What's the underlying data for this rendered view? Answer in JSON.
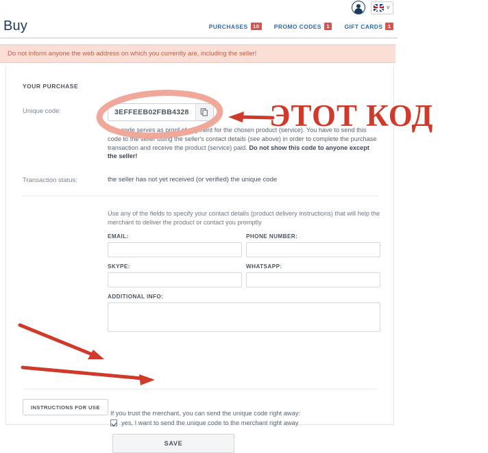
{
  "topbar": {
    "avatar_icon": "user-avatar-icon",
    "language_flag": "uk-flag-icon",
    "caret": "˅"
  },
  "header": {
    "brand": "Buy",
    "nav": [
      {
        "label": "PURCHASES",
        "badge": "10"
      },
      {
        "label": "PROMO CODES",
        "badge": "1"
      },
      {
        "label": "GIFT CARDS",
        "badge": "1"
      }
    ]
  },
  "warning": {
    "text": "Do not inform anyone the web address on which you currently are, including the seller!"
  },
  "purchase": {
    "section_title": "YOUR PURCHASE",
    "unique_code_label": "Unique code:",
    "unique_code_value": "3EFFEEB02FBB4328",
    "copy_icon": "copy-icon",
    "code_description_part1": "This code serves as proof of payment for the chosen product (service). You have to send this code to the seller using the seller's contact details (see above) in order to complete the purchase transaction and receive the product (service) paid. ",
    "code_description_bold": "Do not show this code to anyone except the seller!",
    "transaction_status_label": "Transaction status:",
    "transaction_status_value": "the seller has not yet received (or verified) the unique code"
  },
  "contact": {
    "hint": "Use any of the fields to specify your contact details (product delivery instructions) that will help the merchant to deliver the product or contact you promptly",
    "fields": {
      "email_label": "EMAIL:",
      "email_value": "",
      "email_placeholder": "",
      "phone_label": "PHONE NUMBER:",
      "phone_value": "",
      "phone_placeholder": "",
      "skype_label": "SKYPE:",
      "skype_value": "",
      "skype_placeholder": "",
      "whatsapp_label": "WHATSAPP:",
      "whatsapp_value": "",
      "whatsapp_placeholder": "",
      "additional_label": "ADDITIONAL INFO:",
      "additional_value": "",
      "additional_placeholder": ""
    }
  },
  "actions": {
    "trust_line": "If you trust the merchant, you can send the unique code right away:",
    "checkbox_label": "yes, I want to send the unique code to the merchant right away",
    "checkbox_checked": true,
    "save_label": "SAVE",
    "instructions_label": "INSTRUCTIONS FOR USE"
  },
  "annotation": {
    "text": "ЭТОТ КОД",
    "color": "#cf3a2b",
    "arrow_to_code": "arrow-pointing-to-unique-code",
    "arrow_to_checkbox": "arrow-pointing-to-checkbox",
    "arrow_to_save": "arrow-pointing-to-save-button",
    "ellipse_around_code": "hand-drawn-ellipse-around-code"
  },
  "colors": {
    "accent_blue": "#2f6aa8",
    "badge_red": "#d9534f",
    "warning_bg": "#fbded5",
    "warning_text": "#b9604a",
    "annotation_red": "#cf3a2b",
    "ellipse_pink": "#f0a89a"
  }
}
